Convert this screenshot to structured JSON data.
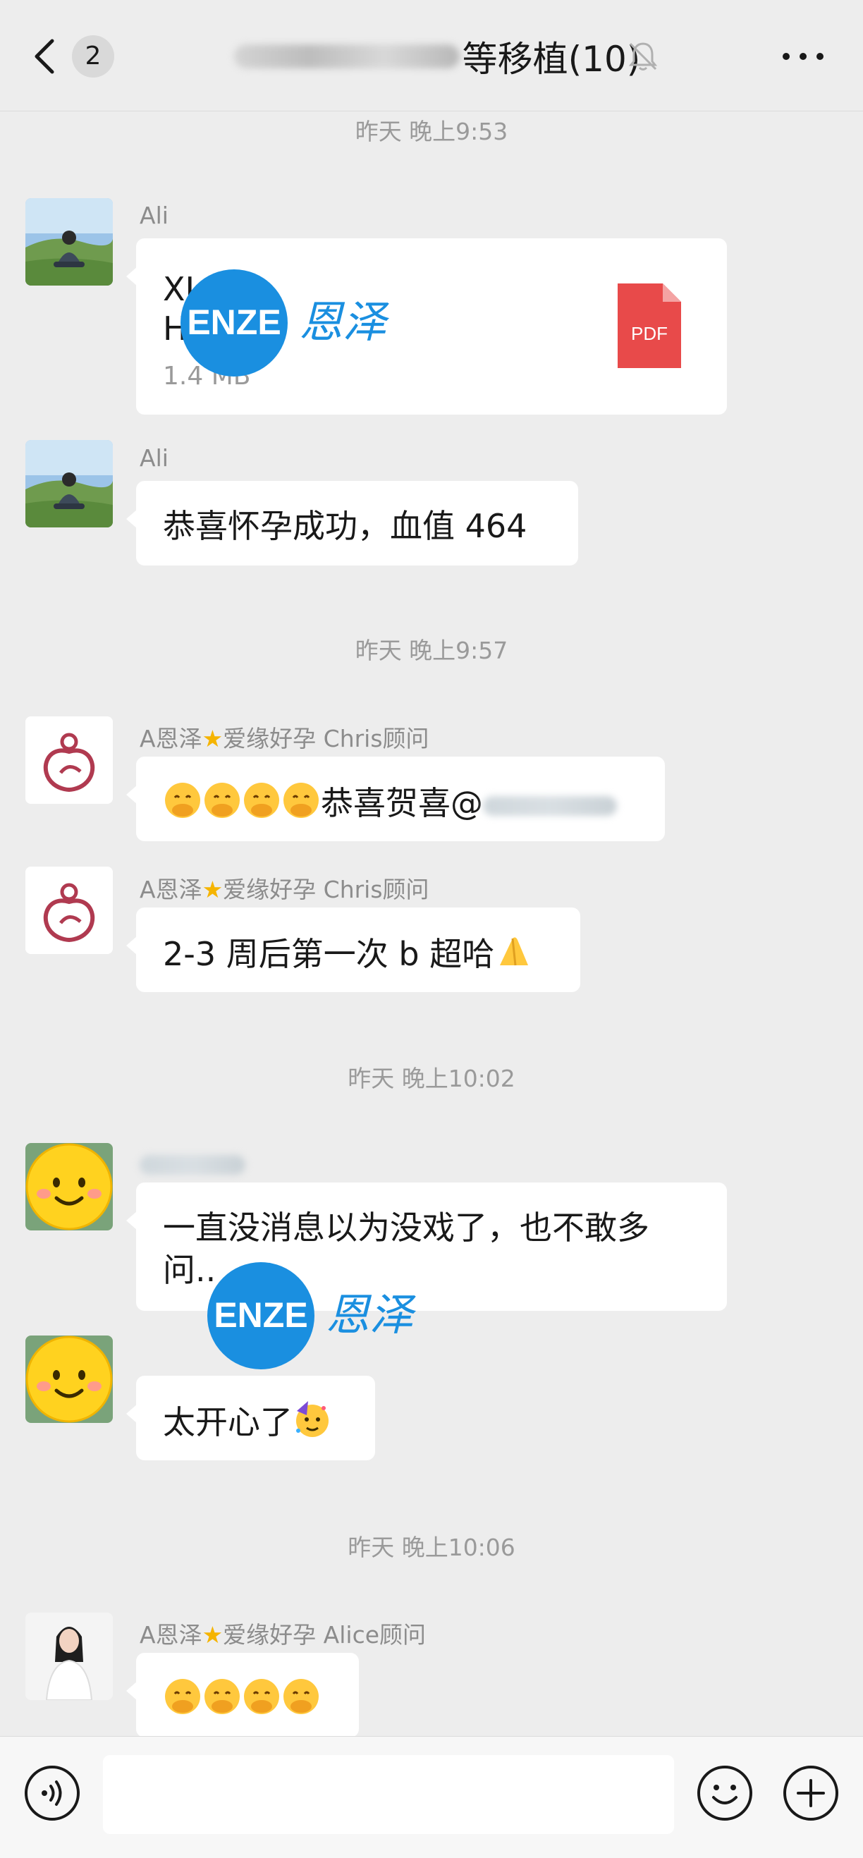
{
  "header": {
    "unread_count": "2",
    "title": "等移植(10)"
  },
  "timestamps": [
    "昨天 晚上9:53",
    "昨天 晚上9:57",
    "昨天 晚上10:02",
    "昨天 晚上10:06"
  ],
  "messages": [
    {
      "sender": "Ali",
      "type": "file",
      "file_name_line1": "XI  й",
      "file_name_line2": "Н     ы  р",
      "file_size": "1.4 MB",
      "file_type": "PDF"
    },
    {
      "sender": "Ali",
      "text": "恭喜怀孕成功，血值 464"
    },
    {
      "sender_prefix": "A恩泽",
      "sender_suffix": "爱缘好孕 Chris顾问",
      "text": "恭喜贺喜@"
    },
    {
      "sender_prefix": "A恩泽",
      "sender_suffix": "爱缘好孕 Chris顾问",
      "text": "2-3 周后第一次 b 超哈"
    },
    {
      "text_line1": "一直没消息以为没戏了，也不敢多",
      "text_line2": "问.."
    },
    {
      "text": "太开心了"
    },
    {
      "sender_prefix": "A恩泽",
      "sender_suffix": "爱缘好孕 Alice顾问"
    }
  ],
  "watermark": {
    "brand": "ENZE",
    "brand_cn": "恩泽"
  },
  "colors": {
    "background": "#ededed",
    "bubble": "#ffffff",
    "pdf_red": "#e84a4a",
    "watermark_blue": "#1a8fe0"
  },
  "icons": [
    "back-arrow-icon",
    "mute-bell-icon",
    "more-icon",
    "pdf-icon",
    "voice-icon",
    "emoji-icon",
    "plus-icon"
  ]
}
